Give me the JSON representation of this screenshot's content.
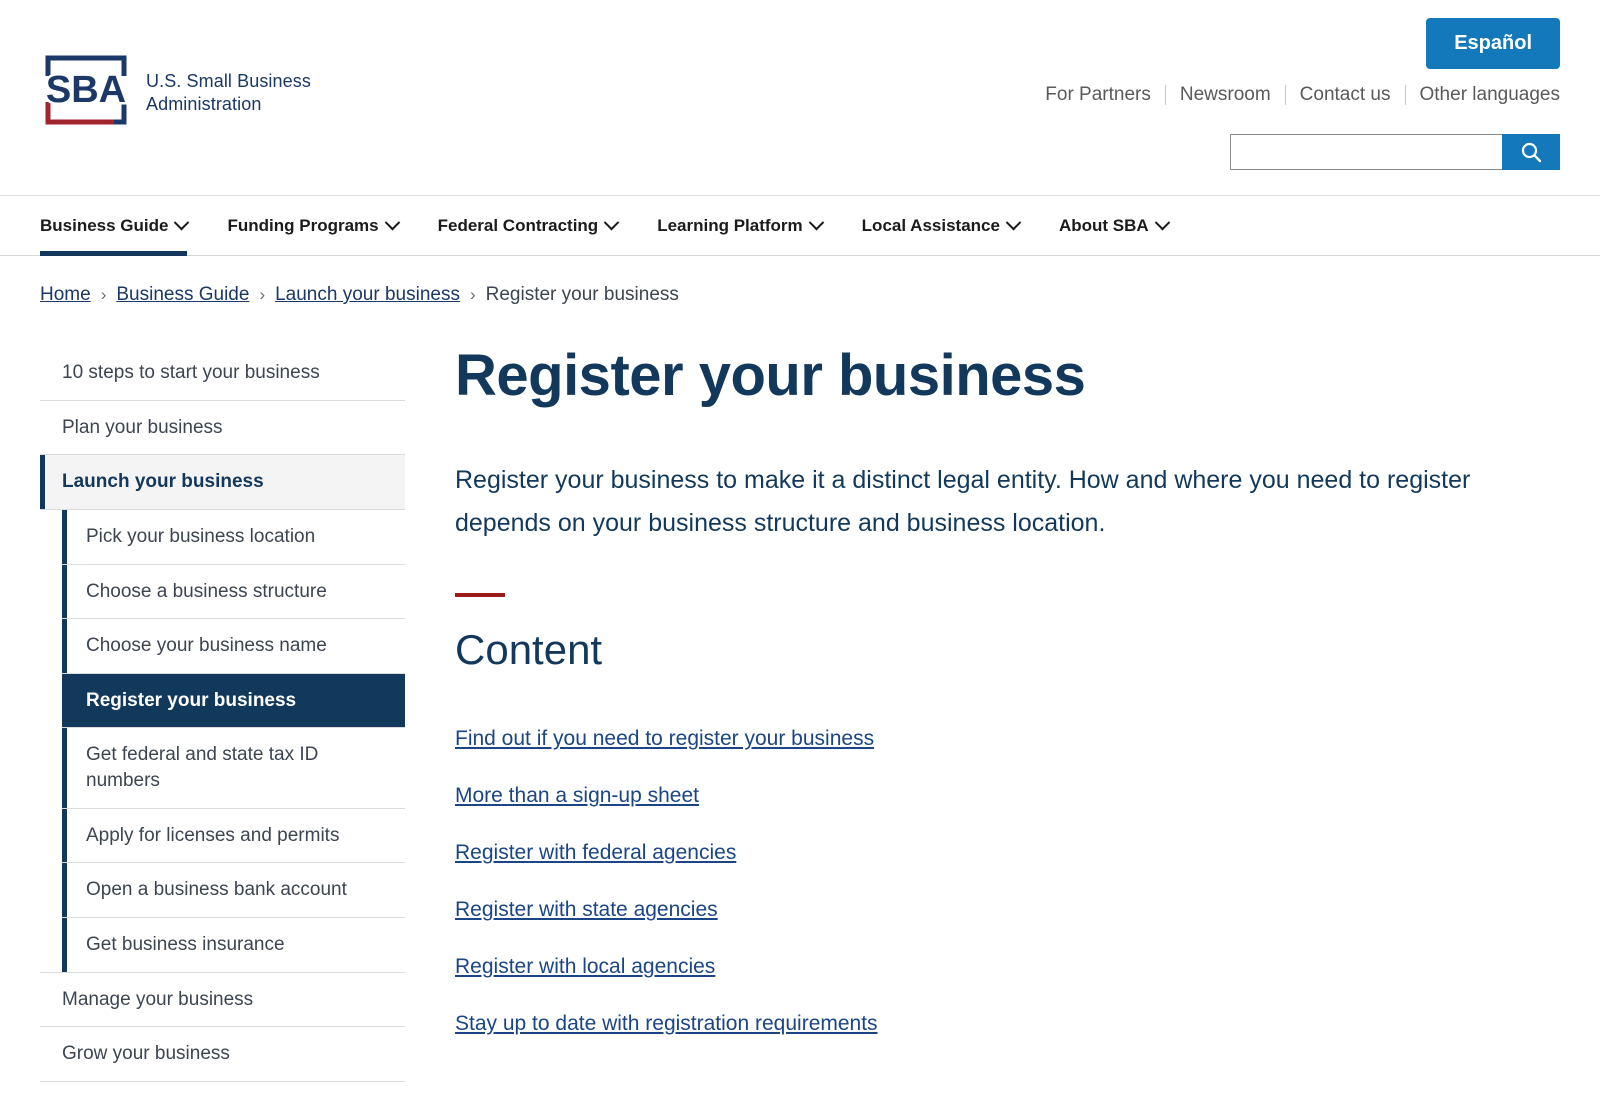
{
  "header": {
    "logo": {
      "mark_name": "sba-logo",
      "org_name": "U.S. Small Business\nAdministration",
      "navy": "#1b3866",
      "red": "#a2242f"
    },
    "espanol_label": "Español",
    "util_links": [
      "For Partners",
      "Newsroom",
      "Contact us",
      "Other languages"
    ],
    "search": {
      "value": "",
      "placeholder": "",
      "icon": "search-icon"
    },
    "accent_blue": "#1379bb"
  },
  "mainnav": {
    "items": [
      {
        "label": "Business Guide",
        "active": true
      },
      {
        "label": "Funding Programs",
        "active": false
      },
      {
        "label": "Federal Contracting",
        "active": false
      },
      {
        "label": "Learning Platform",
        "active": false
      },
      {
        "label": "Local Assistance",
        "active": false
      },
      {
        "label": "About SBA",
        "active": false
      }
    ],
    "active_underline_color": "#12395b"
  },
  "breadcrumb": {
    "items": [
      "Home",
      "Business Guide",
      "Launch your business"
    ],
    "separator": "›",
    "current": "Register your business"
  },
  "sidebar": {
    "items": [
      {
        "label": "10 steps to start your business"
      },
      {
        "label": "Plan your business"
      },
      {
        "label": "Launch your business",
        "current": true
      }
    ],
    "sub_items": [
      {
        "label": "Pick your business location",
        "active": false
      },
      {
        "label": "Choose a business structure",
        "active": false
      },
      {
        "label": "Choose your business name",
        "active": false
      },
      {
        "label": "Register your business",
        "active": true
      },
      {
        "label": "Get federal and state tax ID numbers",
        "active": false
      },
      {
        "label": "Apply for licenses and permits",
        "active": false
      },
      {
        "label": "Open a business bank account",
        "active": false
      },
      {
        "label": "Get business insurance",
        "active": false
      }
    ],
    "items_after": [
      {
        "label": "Manage your business"
      },
      {
        "label": "Grow your business"
      }
    ],
    "active_bg": "#12395b",
    "current_bg": "#f4f4f4"
  },
  "main": {
    "title": "Register your business",
    "lede": "Register your business to make it a distinct legal entity. How and where you need to register depends on your business structure and business location.",
    "rule_color": "#9b1b1b",
    "section_title": "Content",
    "content_links": [
      "Find out if you need to register your business",
      "More than a sign-up sheet",
      "Register with federal agencies",
      "Register with state agencies",
      "Register with local agencies",
      "Stay up to date with registration requirements"
    ]
  }
}
